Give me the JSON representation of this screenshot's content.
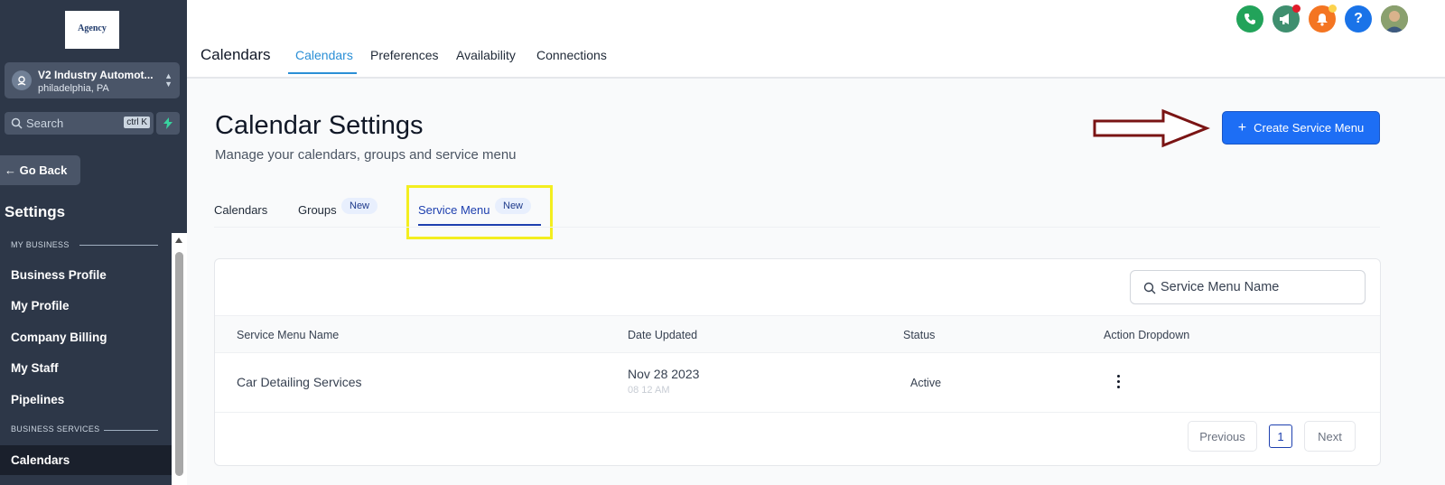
{
  "sidebar": {
    "logo_text": "Agency",
    "account": {
      "name": "V2 Industry Automot...",
      "location": "philadelphia, PA"
    },
    "search": {
      "placeholder": "Search",
      "shortcut": "ctrl K"
    },
    "go_back": "Go Back",
    "title": "Settings",
    "sections": [
      {
        "label": "MY BUSINESS",
        "items": [
          "Business Profile",
          "My Profile",
          "Company Billing",
          "My Staff",
          "Pipelines"
        ]
      },
      {
        "label": "BUSINESS SERVICES",
        "items": [
          "Calendars"
        ]
      }
    ],
    "active_item": "Calendars"
  },
  "header": {
    "title": "Calendars",
    "tabs": [
      {
        "label": "Calendars",
        "active": true
      },
      {
        "label": "Preferences",
        "active": false
      },
      {
        "label": "Availability",
        "active": false
      },
      {
        "label": "Connections",
        "active": false
      }
    ],
    "icons": [
      {
        "name": "phone-icon",
        "color": "#22a35a"
      },
      {
        "name": "megaphone-icon",
        "color": "#3f8f6f"
      },
      {
        "name": "bell-icon",
        "color": "#f47522"
      },
      {
        "name": "help-icon",
        "color": "#1a73e8"
      },
      {
        "name": "avatar",
        "color": "#6b7f5a"
      }
    ]
  },
  "main": {
    "title": "Calendar Settings",
    "subtitle": "Manage your calendars, groups and service menu",
    "create_button": "Create Service Menu",
    "sub_tabs": [
      {
        "label": "Calendars",
        "badge": null
      },
      {
        "label": "Groups",
        "badge": "New"
      },
      {
        "label": "Service Menu",
        "badge": "New",
        "active": true
      }
    ],
    "table": {
      "search_placeholder": "Service Menu Name",
      "columns": [
        "Service Menu Name",
        "Date Updated",
        "Status",
        "Action Dropdown"
      ],
      "rows": [
        {
          "name": "Car Detailing Services",
          "date": "Nov 28 2023",
          "time": "08 12 AM",
          "status": "Active"
        }
      ],
      "pagination": {
        "previous": "Previous",
        "page": "1",
        "next": "Next"
      }
    }
  },
  "colors": {
    "sidebar_bg": "#2d3748",
    "accent": "#1d6ef5",
    "highlight": "#f3ee1f",
    "arrow": "#7a1414"
  }
}
